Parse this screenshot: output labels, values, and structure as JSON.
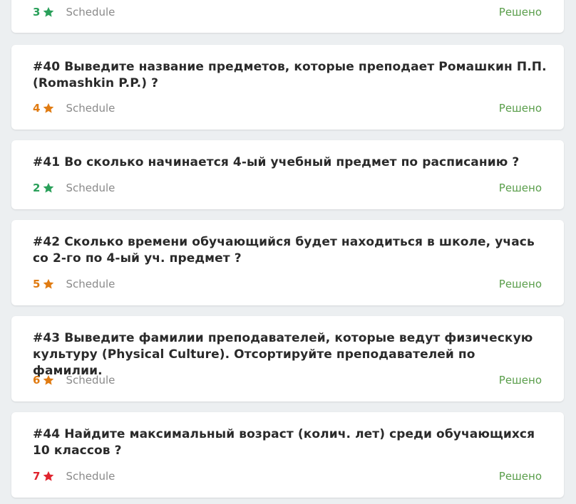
{
  "tasks": [
    {
      "title": "",
      "difficulty": "3",
      "level_color": "#2aa05a",
      "category": "Schedule",
      "status": "Решено"
    },
    {
      "title": "#40 Выведите название предметов, которые преподает Ромашкин П.П. (Romashkin P.P.) ?",
      "difficulty": "4",
      "level_color": "#e07b12",
      "category": "Schedule",
      "status": "Решено"
    },
    {
      "title": "#41 Во сколько начинается 4-ый учебный предмет по расписанию ?",
      "difficulty": "2",
      "level_color": "#2aa05a",
      "category": "Schedule",
      "status": "Решено"
    },
    {
      "title": "#42 Сколько времени обучающийся будет находиться в школе, учась со 2-го по 4-ый уч. предмет ?",
      "difficulty": "5",
      "level_color": "#e07b12",
      "category": "Schedule",
      "status": "Решено"
    },
    {
      "title": "#43 Выведите фамилии преподавателей, которые ведут физическую культуру (Physical Culture). Отсортируйте преподавателей по фамилии.",
      "difficulty": "6",
      "level_color": "#e07b12",
      "category": "Schedule",
      "status": "Решено"
    },
    {
      "title": "#44 Найдите максимальный возраст (колич. лет) среди обучающихся 10 классов ?",
      "difficulty": "7",
      "level_color": "#e0242e",
      "category": "Schedule",
      "status": "Решено"
    }
  ],
  "colors": {
    "status_green": "#5a9e4b",
    "category_gray": "#8a8a8a",
    "background": "#eceff1"
  }
}
